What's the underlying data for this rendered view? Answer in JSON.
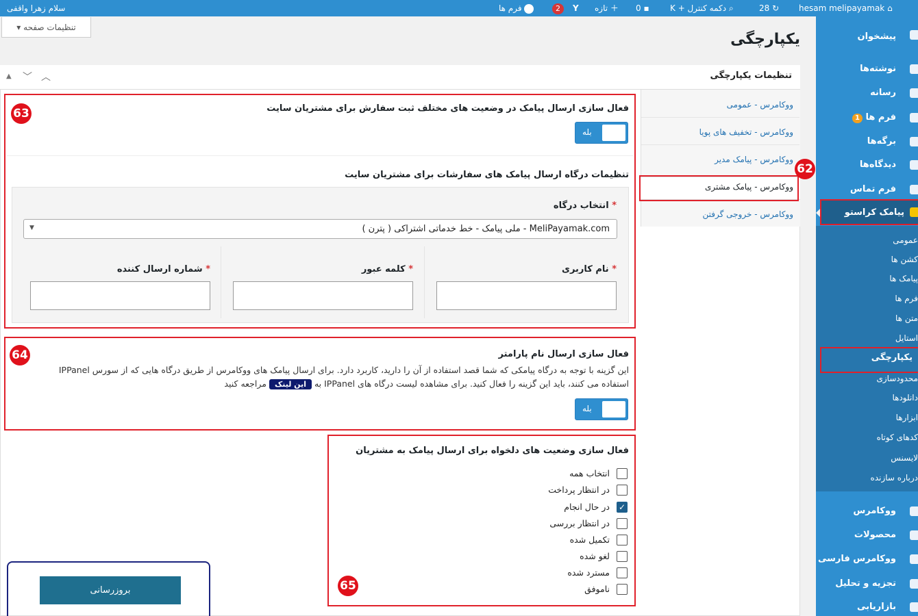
{
  "adminbar": {
    "greeting": "سلام زهرا واقفی",
    "forms": "فرم ها",
    "forms_count": "2",
    "new": "تازه",
    "comments": "0",
    "shortcut": "دکمه کنترل + K",
    "updates": "28",
    "site": "hesam melipayamak"
  },
  "sidebar": {
    "items": [
      {
        "label": "پیشخوان"
      },
      {
        "label": "نوشته‌ها"
      },
      {
        "label": "رسانه"
      },
      {
        "label": "فرم ها",
        "badge": "1"
      },
      {
        "label": "برگه‌ها"
      },
      {
        "label": "دیدگاه‌ها"
      },
      {
        "label": "فرم تماس"
      },
      {
        "label": "پیامک کراستو"
      }
    ],
    "submenu": [
      "عمومی",
      "کشن ها",
      "پیامک ها",
      "فرم ها",
      "متن ها",
      "استایل",
      "یکپارچگی",
      "محدودسازی",
      "دانلودها",
      "ابزارها",
      "کدهای کوتاه",
      "لایسنس",
      "درباره سازنده"
    ],
    "bottom": [
      {
        "label": "ووکامرس"
      },
      {
        "label": "محصولات"
      },
      {
        "label": "ووکامرس فارسی"
      },
      {
        "label": "تجزیه و تحلیل"
      },
      {
        "label": "بازاریابی"
      }
    ]
  },
  "screen_options": "تنظیمات صفحه",
  "page_title": "یکپارچگی",
  "panel_title": "تنظیمات یکپارچگی",
  "tabs": [
    "ووکامرس - عمومی",
    "ووکامرس - تخفیف های پویا",
    "ووکامرس - پیامک مدیر",
    "ووکامرس - پیامک مشتری",
    "ووکامرس - خروجی گرفتن"
  ],
  "annotations": [
    "63",
    "62",
    "64",
    "65"
  ],
  "section1": {
    "title": "فعال سازی ارسال پیامک در وضعیت های مختلف ثبت سفارش برای مشتریان سایت",
    "toggle_label": "بله"
  },
  "gateway": {
    "title": "تنظیمات درگاه ارسال پیامک های سفارشات برای مشتریان سایت",
    "select_label": "انتخاب درگاه",
    "select_value": "MeliPayamak.com - ملی پیامک - خط خدماتی اشتراکی ( پترن )",
    "username_label": "نام کاربری",
    "password_label": "کلمه عبور",
    "sender_label": "شماره ارسال کننده",
    "required_mark": "*"
  },
  "section2": {
    "title": "فعال سازی ارسال نام پارامتر",
    "desc1": "این گزینه با توجه به درگاه پیامکی که شما قصد استفاده از آن را دارید، کاربرد دارد. برای ارسال پیامک های ووکامرس از طریق درگاه هایی که از سورس IPPanel",
    "desc2a": "استفاده می کنند، باید این گزینه را فعال کنید. برای مشاهده لیست درگاه های IPPanel به",
    "link": "این لینک",
    "desc2b": "مراجعه کنید",
    "toggle_label": "بله"
  },
  "section3": {
    "title": "فعال سازی وضعیت های دلخواه برای ارسال پیامک به مشتریان",
    "options": [
      {
        "label": "انتخاب همه",
        "checked": false
      },
      {
        "label": "در انتظار پرداخت",
        "checked": false
      },
      {
        "label": "در حال انجام",
        "checked": true
      },
      {
        "label": "در انتظار بررسی",
        "checked": false
      },
      {
        "label": "تکمیل شده",
        "checked": false
      },
      {
        "label": "لغو شده",
        "checked": false
      },
      {
        "label": "مسترد شده",
        "checked": false
      },
      {
        "label": "ناموفق",
        "checked": false
      }
    ]
  },
  "save_button": "بروزرسانی"
}
